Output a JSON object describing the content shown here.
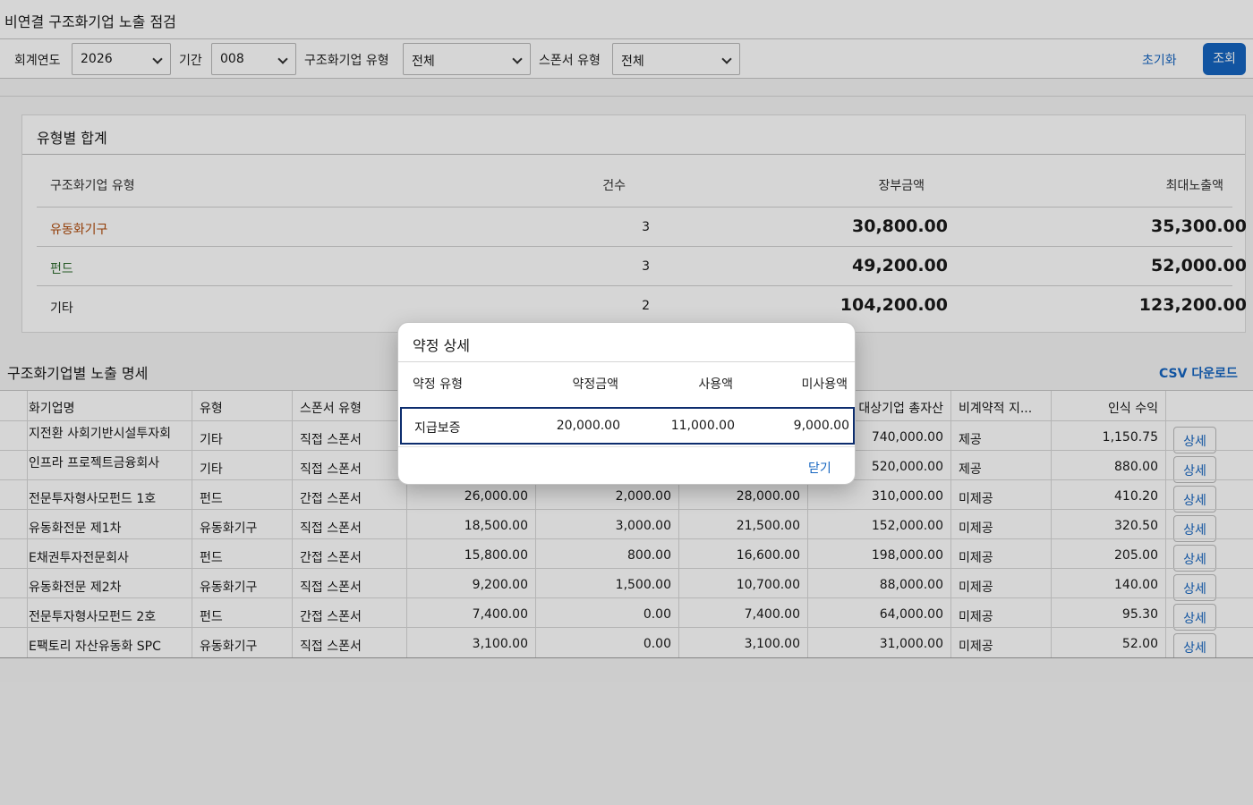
{
  "title": "비연결 구조화기업 노출 점검",
  "filters": {
    "year_label": "회계연도",
    "year_value": "2026",
    "period_label": "기간",
    "period_value": "008",
    "entity_type_label": "구조화기업 유형",
    "entity_type_value": "전체",
    "sponsor_type_label": "스폰서 유형",
    "sponsor_type_value": "전체",
    "reset_label": "초기화",
    "search_label": "조회"
  },
  "summary": {
    "title": "유형별 합계",
    "headers": {
      "type": "구조화기업 유형",
      "count": "건수",
      "book": "장부금액",
      "max": "최대노출액"
    },
    "rows": [
      {
        "type": "유동화기구",
        "count": "3",
        "book": "30,800.00",
        "max": "35,300.00",
        "color": "#b04a0a"
      },
      {
        "type": "펀드",
        "count": "3",
        "book": "49,200.00",
        "max": "52,000.00",
        "color": "#2e6b2e"
      },
      {
        "type": "기타",
        "count": "2",
        "book": "104,200.00",
        "max": "123,200.00",
        "color": "#222222"
      }
    ]
  },
  "detail": {
    "title": "구조화기업별 노출 명세",
    "csv_label": "CSV 다운로드",
    "headers": {
      "name": "화기업명",
      "type": "유형",
      "sponsor": "스폰서 유형",
      "total_assets": "대상기업 총자산",
      "commit": "비계약적 지...",
      "income": "인식 수익"
    },
    "detail_button": "상세",
    "rows": [
      {
        "name": "지전환 사회기반시설투자회",
        "type": "기타",
        "sponsor": "직접 스폰서",
        "c1": "",
        "c2": "",
        "c3": "",
        "total_assets": "740,000.00",
        "commit": "제공",
        "income": "1,150.75"
      },
      {
        "name": "인프라 프로젝트금융회사",
        "type": "기타",
        "sponsor": "직접 스폰서",
        "c1": "",
        "c2": "",
        "c3": "",
        "total_assets": "520,000.00",
        "commit": "제공",
        "income": "880.00"
      },
      {
        "name": "전문투자형사모펀드 1호",
        "type": "펀드",
        "sponsor": "간접 스폰서",
        "c1": "26,000.00",
        "c2": "2,000.00",
        "c3": "28,000.00",
        "total_assets": "310,000.00",
        "commit": "미제공",
        "income": "410.20"
      },
      {
        "name": "유동화전문 제1차",
        "type": "유동화기구",
        "sponsor": "직접 스폰서",
        "c1": "18,500.00",
        "c2": "3,000.00",
        "c3": "21,500.00",
        "total_assets": "152,000.00",
        "commit": "미제공",
        "income": "320.50"
      },
      {
        "name": "E채권투자전문회사",
        "type": "펀드",
        "sponsor": "간접 스폰서",
        "c1": "15,800.00",
        "c2": "800.00",
        "c3": "16,600.00",
        "total_assets": "198,000.00",
        "commit": "미제공",
        "income": "205.00"
      },
      {
        "name": "유동화전문 제2차",
        "type": "유동화기구",
        "sponsor": "직접 스폰서",
        "c1": "9,200.00",
        "c2": "1,500.00",
        "c3": "10,700.00",
        "total_assets": "88,000.00",
        "commit": "미제공",
        "income": "140.00"
      },
      {
        "name": "전문투자형사모펀드 2호",
        "type": "펀드",
        "sponsor": "간접 스폰서",
        "c1": "7,400.00",
        "c2": "0.00",
        "c3": "7,400.00",
        "total_assets": "64,000.00",
        "commit": "미제공",
        "income": "95.30"
      },
      {
        "name": "E팩토리 자산유동화 SPC",
        "type": "유동화기구",
        "sponsor": "직접 스폰서",
        "c1": "3,100.00",
        "c2": "0.00",
        "c3": "3,100.00",
        "total_assets": "31,000.00",
        "commit": "미제공",
        "income": "52.00"
      }
    ]
  },
  "modal": {
    "title": "약정 상세",
    "headers": {
      "type": "약정 유형",
      "amount": "약정금액",
      "used": "사용액",
      "unused": "미사용액"
    },
    "row": {
      "type": "지급보증",
      "amount": "20,000.00",
      "used": "11,000.00",
      "unused": "9,000.00"
    },
    "close_label": "닫기"
  }
}
